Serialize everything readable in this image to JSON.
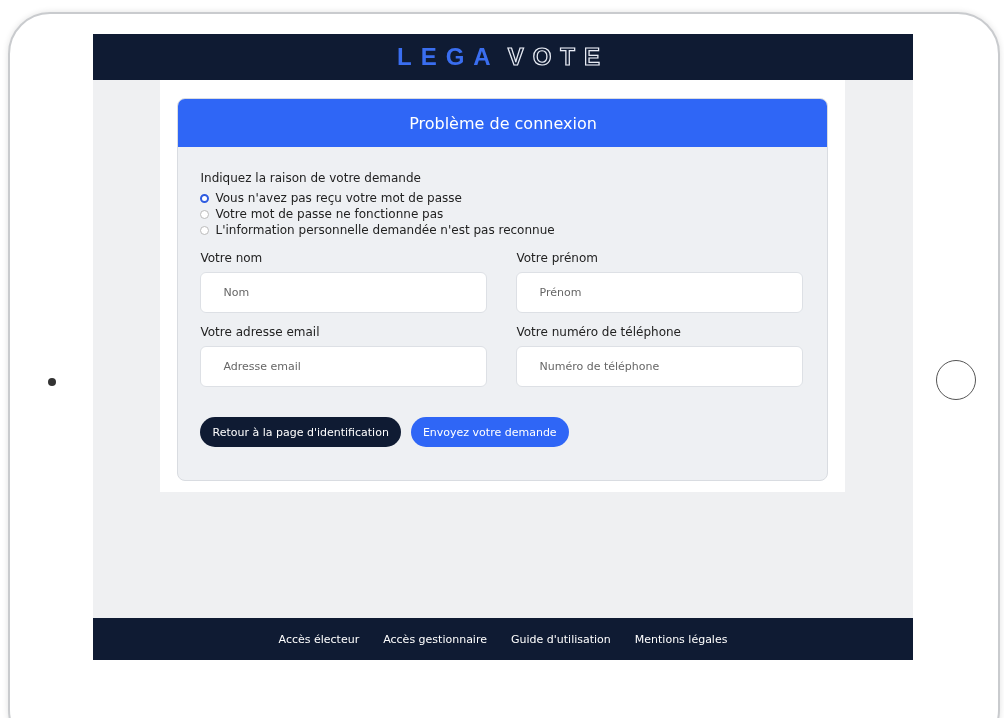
{
  "logo": {
    "part_1": "LEGA",
    "part_2": "VOTE"
  },
  "card": {
    "title": "Problème de connexion",
    "question": "Indiquez la raison de votre demande",
    "reasons": [
      {
        "label": "Vous n'avez pas reçu votre mot de passe",
        "selected": true
      },
      {
        "label": "Votre mot de passe ne fonctionne pas",
        "selected": false
      },
      {
        "label": "L'information personnelle demandée n'est pas reconnue",
        "selected": false
      }
    ],
    "fields": [
      {
        "label": "Votre nom",
        "placeholder": "Nom"
      },
      {
        "label": "Votre prénom",
        "placeholder": "Prénom"
      },
      {
        "label": "Votre adresse email",
        "placeholder": "Adresse email"
      },
      {
        "label": "Votre numéro de téléphone",
        "placeholder": "Numéro de téléphone"
      }
    ],
    "buttons": [
      {
        "label": "Retour à la page d'identification",
        "kind": "secondary"
      },
      {
        "label": "Envoyez votre demande",
        "kind": "primary"
      }
    ]
  },
  "footer": {
    "links": [
      "Accès électeur",
      "Accès gestionnaire",
      "Guide d'utilisation",
      "Mentions légales"
    ]
  }
}
